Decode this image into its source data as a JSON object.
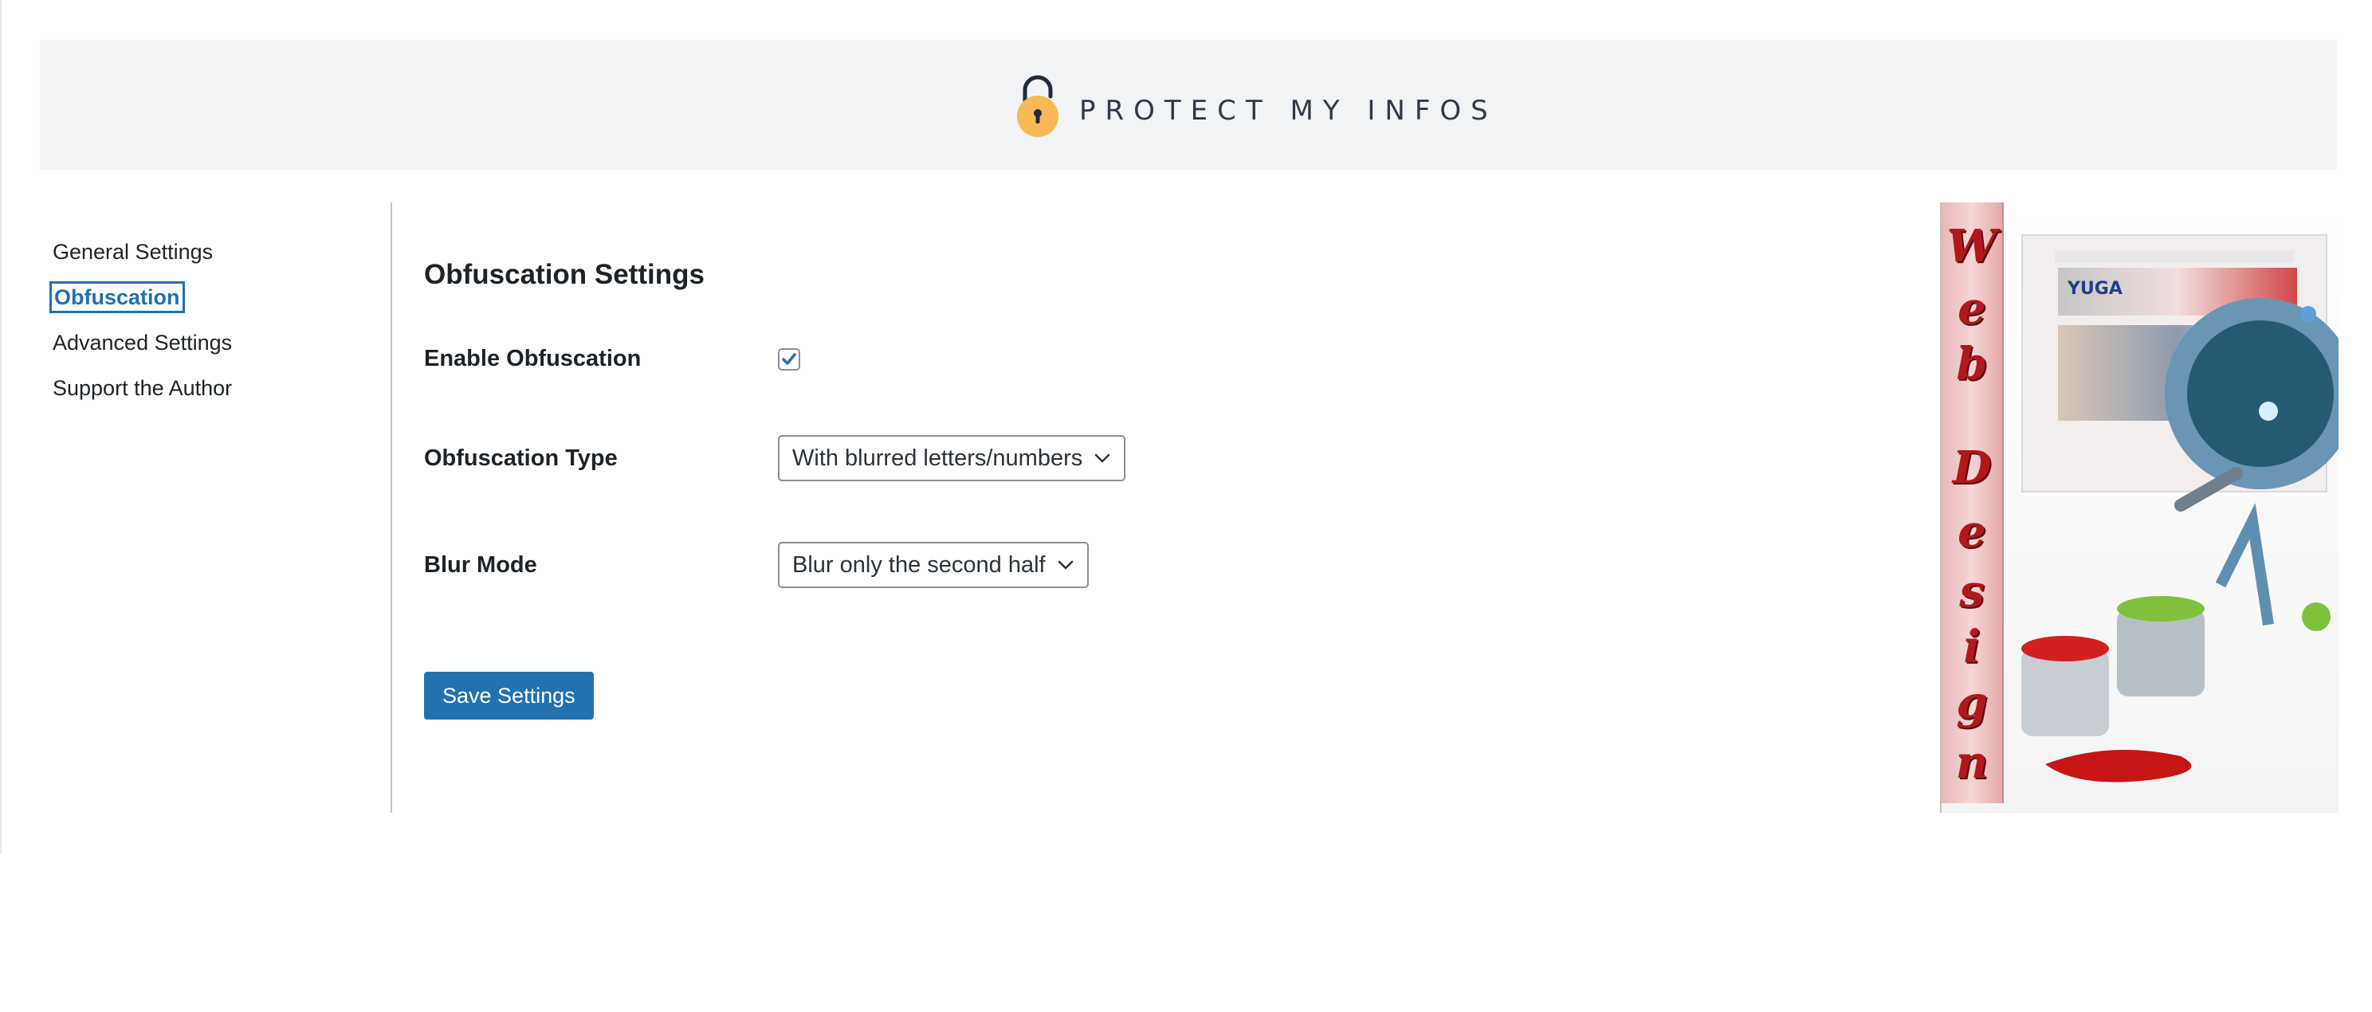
{
  "header": {
    "brand_name": "PROTECT MY INFOS",
    "logo_icon": "lock-icon",
    "colors": {
      "lock_body": "#f7b955",
      "lock_shackle": "#1f2a3a"
    }
  },
  "sidebar": {
    "items": [
      {
        "label": "General Settings",
        "active": false
      },
      {
        "label": "Obfuscation",
        "active": true
      },
      {
        "label": "Advanced Settings",
        "active": false
      },
      {
        "label": "Support the Author",
        "active": false
      }
    ]
  },
  "main": {
    "title": "Obfuscation Settings",
    "fields": {
      "enable": {
        "label": "Enable Obfuscation",
        "checked": true
      },
      "type": {
        "label": "Obfuscation Type",
        "value": "With blurred letters/numbers"
      },
      "blur_mode": {
        "label": "Blur Mode",
        "value": "Blur only the second half"
      }
    },
    "save_label": "Save Settings"
  },
  "promo": {
    "vertical_text": [
      "W",
      "e",
      "b",
      "D",
      "e",
      "s",
      "i",
      "g",
      "n"
    ],
    "screen_logo": "YUGA"
  },
  "colors": {
    "accent": "#2271b1",
    "header_bg": "#f2f3f5",
    "text": "#1d2327"
  }
}
